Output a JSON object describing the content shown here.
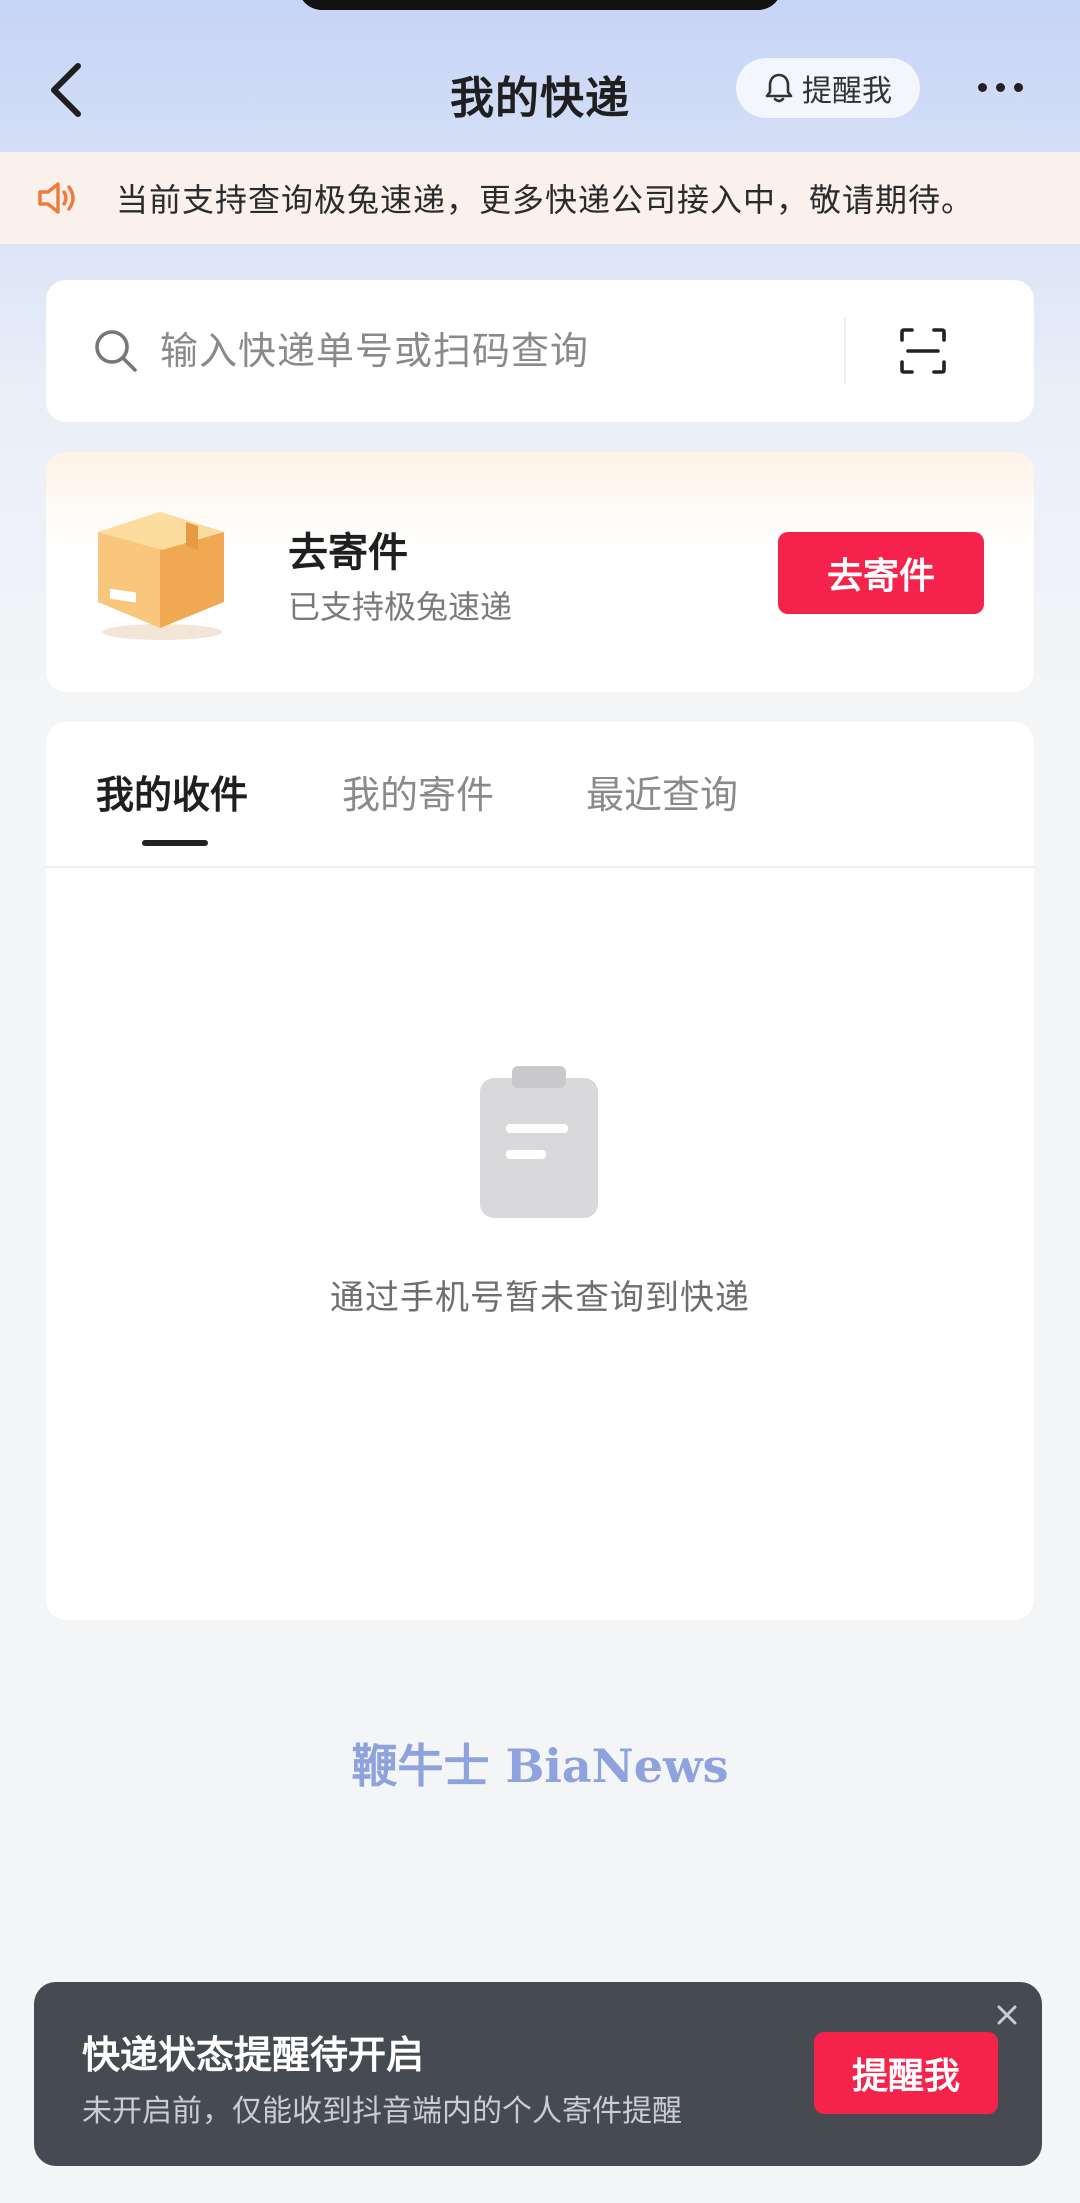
{
  "header": {
    "title": "我的快递",
    "remind_label": "提醒我"
  },
  "notice": {
    "text": "当前支持查询极兔速递，更多快递公司接入中，敬请期待。"
  },
  "search": {
    "placeholder": "输入快递单号或扫码查询"
  },
  "send": {
    "title": "去寄件",
    "subtitle": "已支持极兔速递",
    "button_label": "去寄件"
  },
  "tabs": [
    {
      "label": "我的收件",
      "active": true
    },
    {
      "label": "我的寄件",
      "active": false
    },
    {
      "label": "最近查询",
      "active": false
    }
  ],
  "empty_state": {
    "text": "通过手机号暂未查询到快递"
  },
  "watermark": "鞭牛士 BiaNews",
  "banner": {
    "title": "快递状态提醒待开启",
    "subtitle": "未开启前，仅能收到抖音端内的个人寄件提醒",
    "button_label": "提醒我"
  },
  "colors": {
    "accent": "#f5234b",
    "notice_icon": "#f07a3a",
    "banner_bg": "#464a51"
  },
  "icons": [
    "back-arrow-icon",
    "bell-icon",
    "more-icon",
    "speaker-icon",
    "search-icon",
    "scan-icon",
    "box-icon",
    "clipboard-icon",
    "close-icon"
  ]
}
